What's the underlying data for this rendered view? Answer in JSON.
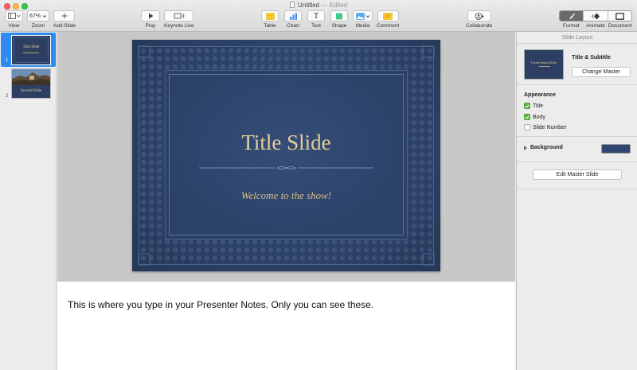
{
  "window": {
    "title": "Untitled",
    "status": "— Edited"
  },
  "toolbar": {
    "view_label": "View",
    "zoom_value": "67%",
    "zoom_label": "Zoom",
    "add_slide_label": "Add Slide",
    "play_label": "Play",
    "keynote_live_label": "Keynote Live",
    "table_label": "Table",
    "chart_label": "Chart",
    "text_label": "Text",
    "text_glyph": "T",
    "shape_label": "Shape",
    "media_label": "Media",
    "comment_label": "Comment",
    "collaborate_label": "Collaborate",
    "format_label": "Format",
    "animate_label": "Animate",
    "document_label": "Document"
  },
  "navigator": {
    "slides": [
      {
        "number": "1",
        "thumb_title": "Title Slide",
        "selected": true
      },
      {
        "number": "2",
        "thumb_title": "Second Slide",
        "selected": false
      }
    ]
  },
  "slide": {
    "title": "Title Slide",
    "subtitle": "Welcome to the show!"
  },
  "notes": {
    "text": "This is where you type in your Presenter Notes. Only you can see these."
  },
  "inspector": {
    "header": "Slide Layout",
    "layout_thumb_text": "Lorem Ipsum Dolor",
    "layout_name": "Title & Subtitle",
    "change_master": "Change Master",
    "appearance_heading": "Appearance",
    "options": [
      {
        "label": "Title",
        "checked": true
      },
      {
        "label": "Body",
        "checked": true
      },
      {
        "label": "Slide Number",
        "checked": false
      }
    ],
    "background_label": "Background",
    "background_color": "#2f4770",
    "edit_master": "Edit Master Slide"
  },
  "colors": {
    "selection_blue": "#2f8bf0",
    "slide_navy": "#2c3f63",
    "title_gold": "#e6cd98"
  }
}
